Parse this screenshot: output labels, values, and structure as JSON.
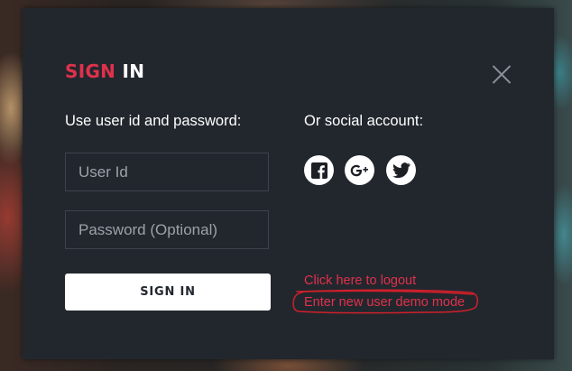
{
  "title": {
    "part1": "SIGN",
    "part2": "IN"
  },
  "left_column": {
    "heading": "Use user id and password:",
    "user_id_placeholder": "User Id",
    "password_placeholder": "Password (Optional)",
    "signin_button": "SIGN IN"
  },
  "right_column": {
    "heading": "Or social account:",
    "social": [
      {
        "name": "facebook-icon"
      },
      {
        "name": "google-plus-icon"
      },
      {
        "name": "twitter-icon"
      }
    ],
    "logout_link": "Click here to logout",
    "demo_link": "Enter new user demo mode"
  },
  "colors": {
    "accent": "#e0314b",
    "modal_bg": "#22272e",
    "annotation": "#d0202a"
  }
}
